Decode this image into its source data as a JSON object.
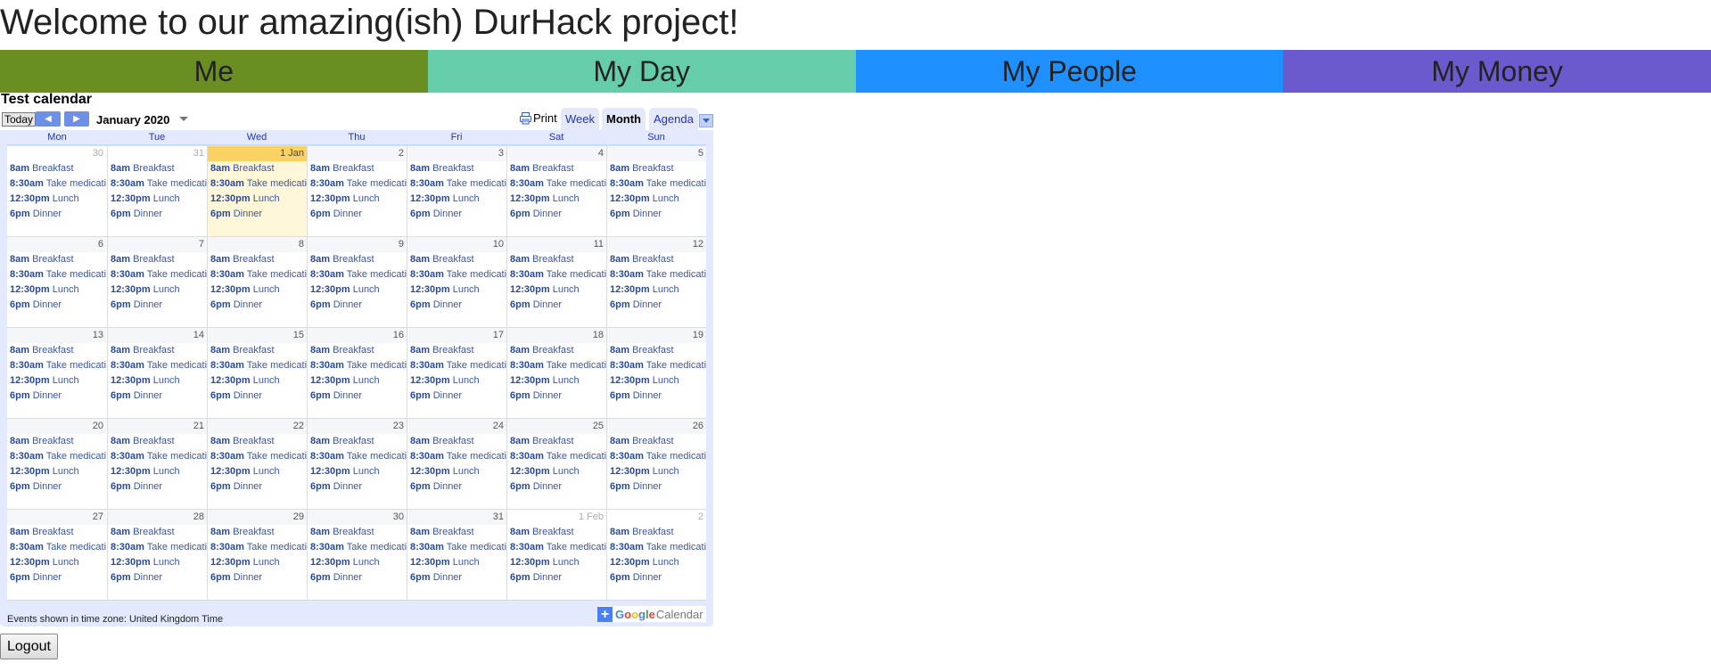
{
  "page": {
    "title": "Welcome to our amazing(ish) DurHack project!"
  },
  "nav": {
    "tabs": [
      {
        "label": "Me",
        "color": "#6b8e23"
      },
      {
        "label": "My Day",
        "color": "#66cdaa"
      },
      {
        "label": "My People",
        "color": "#1e90ff"
      },
      {
        "label": "My Money",
        "color": "#6a5acd"
      }
    ]
  },
  "calendar": {
    "title": "Test calendar",
    "today_label": "Today",
    "prev_icon": "chevron-left-icon",
    "next_icon": "chevron-right-icon",
    "month_label": "January 2020",
    "print_label": "Print",
    "views": [
      {
        "label": "Week",
        "active": false
      },
      {
        "label": "Month",
        "active": true
      },
      {
        "label": "Agenda",
        "active": false
      }
    ],
    "weekdays": [
      "Mon",
      "Tue",
      "Wed",
      "Thu",
      "Fri",
      "Sat",
      "Sun"
    ],
    "weeks": [
      [
        {
          "label": "30",
          "other": true
        },
        {
          "label": "31",
          "other": true
        },
        {
          "label": "1 Jan",
          "today": true
        },
        {
          "label": "2"
        },
        {
          "label": "3"
        },
        {
          "label": "4"
        },
        {
          "label": "5"
        }
      ],
      [
        {
          "label": "6"
        },
        {
          "label": "7"
        },
        {
          "label": "8"
        },
        {
          "label": "9"
        },
        {
          "label": "10"
        },
        {
          "label": "11"
        },
        {
          "label": "12"
        }
      ],
      [
        {
          "label": "13"
        },
        {
          "label": "14"
        },
        {
          "label": "15"
        },
        {
          "label": "16"
        },
        {
          "label": "17"
        },
        {
          "label": "18"
        },
        {
          "label": "19"
        }
      ],
      [
        {
          "label": "20"
        },
        {
          "label": "21"
        },
        {
          "label": "22"
        },
        {
          "label": "23"
        },
        {
          "label": "24"
        },
        {
          "label": "25"
        },
        {
          "label": "26"
        }
      ],
      [
        {
          "label": "27"
        },
        {
          "label": "28"
        },
        {
          "label": "29"
        },
        {
          "label": "30"
        },
        {
          "label": "31"
        },
        {
          "label": "1 Feb",
          "other": true
        },
        {
          "label": "2",
          "other": true
        }
      ]
    ],
    "daily_events": [
      {
        "time": "8am",
        "title": "Breakfast"
      },
      {
        "time": "8:30am",
        "title": "Take medication"
      },
      {
        "time": "12:30pm",
        "title": "Lunch"
      },
      {
        "time": "6pm",
        "title": "Dinner"
      }
    ],
    "timezone_text": "Events shown in time zone: United Kingdom Time",
    "brand": {
      "plus": "+",
      "google": "Google",
      "calendar": "Calendar"
    }
  },
  "logout_label": "Logout"
}
